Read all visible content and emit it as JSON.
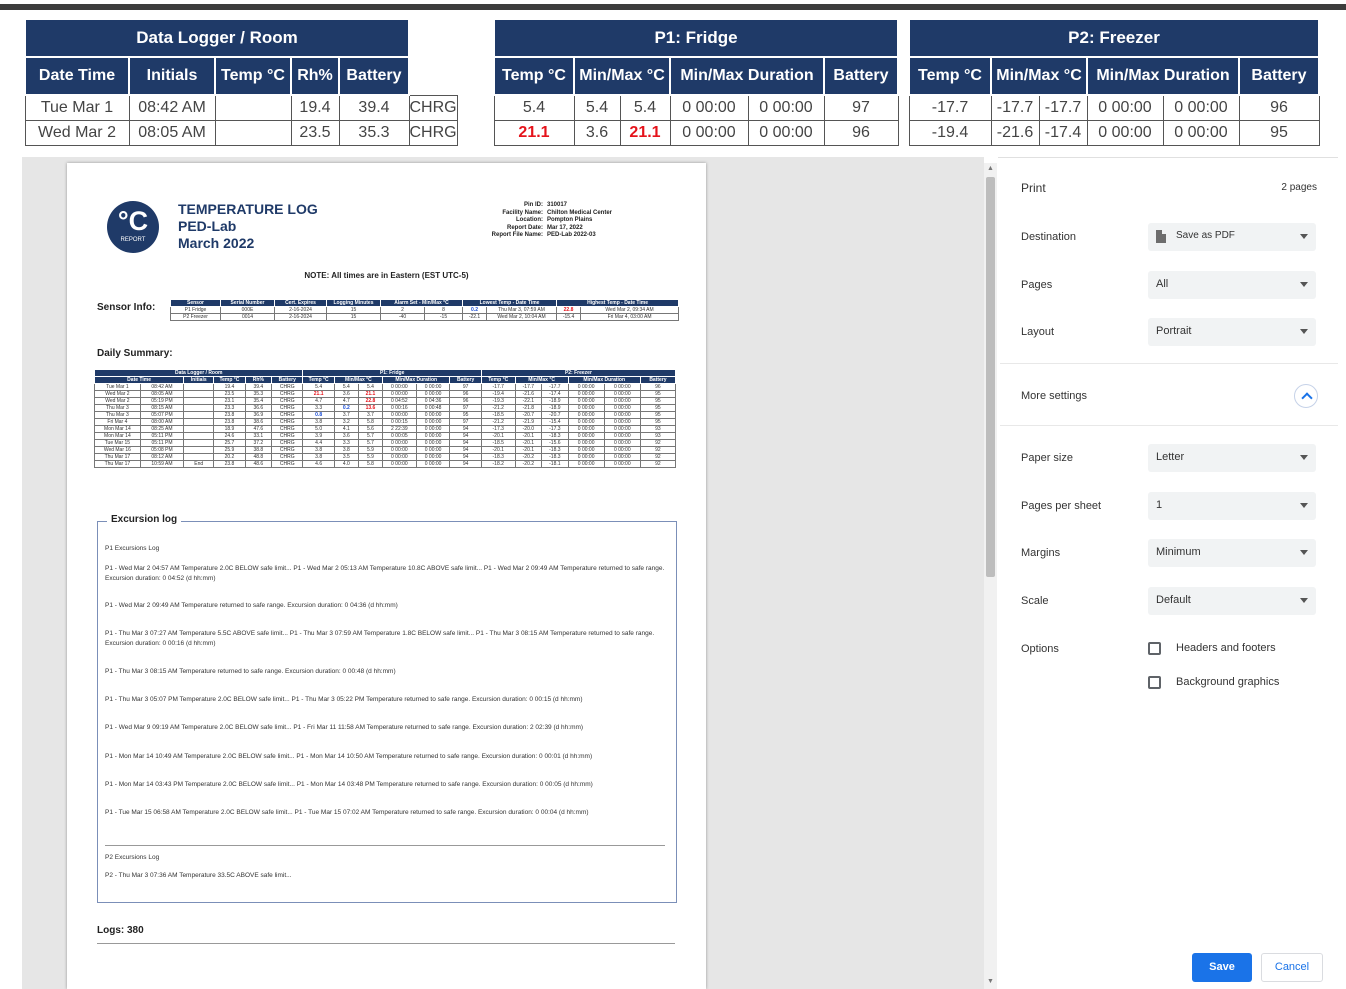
{
  "top_table": {
    "groups": [
      "Data Logger / Room",
      "P1: Fridge",
      "P2: Freezer"
    ],
    "room_headers": [
      "Date Time",
      "Initials",
      "Temp °C",
      "Rh%",
      "Battery"
    ],
    "probe_headers": [
      "Temp °C",
      "Min/Max °C",
      "Min/Max Duration",
      "Battery"
    ],
    "rows": [
      {
        "room": [
          "Tue Mar 1",
          "08:42 AM",
          "",
          "19.4",
          "39.4",
          "CHRG"
        ],
        "p1": [
          "5.4",
          "5.4",
          "5.4",
          "0 00:00",
          "0 00:00",
          "97"
        ],
        "p2": [
          "-17.7",
          "-17.7",
          "-17.7",
          "0 00:00",
          "0 00:00",
          "96"
        ]
      },
      {
        "room": [
          "Wed Mar 2",
          "08:05 AM",
          "",
          "23.5",
          "35.3",
          "CHRG"
        ],
        "p1": [
          "21.1",
          "3.6",
          "21.1",
          "0 00:00",
          "0 00:00",
          "96"
        ],
        "p2": [
          "-19.4",
          "-21.6",
          "-17.4",
          "0 00:00",
          "0 00:00",
          "95"
        ]
      }
    ]
  },
  "report": {
    "logo_main": "°C",
    "logo_sub": "REPORT",
    "title_lines": [
      "TEMPERATURE LOG",
      "PED-Lab",
      "March 2022"
    ],
    "meta": [
      {
        "k": "Pin ID:",
        "v": "310017"
      },
      {
        "k": "Facility Name:",
        "v": "Chilton Medical Center"
      },
      {
        "k": "Location:",
        "v": "Pompton Plains"
      },
      {
        "k": "Report Date:",
        "v": "Mar 17, 2022"
      },
      {
        "k": "Report File Name:",
        "v": "PED-Lab 2022-03"
      }
    ],
    "note": "NOTE: All times are in Eastern (EST UTC-5)",
    "sensor_label": "Sensor Info:",
    "sensor_headers": [
      "Sensor",
      "Serial Number",
      "Cert. Expires",
      "Logging Minutes",
      "Alarm Set - Min/Max °C",
      "Lowest Temp - Date Time",
      "Highest Temp - Date Time"
    ],
    "sensor_rows": [
      [
        "P1 Fridge",
        "000E",
        "2-16-2024",
        "15",
        "2",
        "8",
        "0.2",
        "Thu Mar 3, 07:59 AM",
        "22.8",
        "Wed Mar 2, 09:34 AM"
      ],
      [
        "P2 Freezer",
        "0014",
        "2-16-2024",
        "15",
        "-40",
        "-15",
        "-22.1",
        "Wed Mar 2, 10:04 AM",
        "-15.4",
        "Fri Mar 4, 03:00 AM"
      ]
    ],
    "daily_label": "Daily Summary:",
    "daily_groups": [
      "Data Logger / Room",
      "P1: Fridge",
      "P2: Freezer"
    ],
    "daily_headers": [
      "Date Time",
      "Initials",
      "Temp °C",
      "Rh%",
      "Battery",
      "Temp °C",
      "Min/Max °C",
      "Min/Max Duration",
      "Battery",
      "Temp °C",
      "Min/Max °C",
      "Min/Max Duration",
      "Battery"
    ],
    "daily_rows": [
      [
        "Tue Mar 1",
        "08:42 AM",
        "",
        "19.4",
        "39.4",
        "CHRG",
        "5.4",
        "5.4",
        "5.4",
        "0 00:00",
        "0 00:00",
        "97",
        "-17.7",
        "-17.7",
        "-17.7",
        "0 00:00",
        "0 00:00",
        "96"
      ],
      [
        "Wed Mar 2",
        "08:05 AM",
        "",
        "23.5",
        "35.3",
        "CHRG",
        "21.1",
        "3.6",
        "21.1",
        "0 00:00",
        "0 00:00",
        "96",
        "-19.4",
        "-21.6",
        "-17.4",
        "0 00:00",
        "0 00:00",
        "95"
      ],
      [
        "Wed Mar 2",
        "05:19 PM",
        "",
        "23.1",
        "35.4",
        "CHRG",
        "4.7",
        "4.7",
        "22.8",
        "0 04:52",
        "0 04:36",
        "96",
        "-19.3",
        "-22.1",
        "-18.9",
        "0 00:00",
        "0 00:00",
        "95"
      ],
      [
        "Thu Mar 3",
        "08:15 AM",
        "",
        "23.3",
        "36.6",
        "CHRG",
        "3.3",
        "0.2",
        "13.6",
        "0 00:16",
        "0 00:48",
        "97",
        "-21.2",
        "-21.8",
        "-18.9",
        "0 00:00",
        "0 00:00",
        "95"
      ],
      [
        "Thu Mar 3",
        "05:07 PM",
        "",
        "23.8",
        "36.9",
        "CHRG",
        "0.8",
        "3.7",
        "3.7",
        "0 00:00",
        "0 00:00",
        "95",
        "-18.5",
        "-20.7",
        "-20.7",
        "0 00:00",
        "0 00:00",
        "95"
      ],
      [
        "Fri Mar 4",
        "08:00 AM",
        "",
        "23.8",
        "38.6",
        "CHRG",
        "3.8",
        "3.2",
        "5.8",
        "0 00:15",
        "0 00:00",
        "97",
        "-21.2",
        "-21.9",
        "-15.4",
        "0 00:00",
        "0 00:00",
        "95"
      ],
      [
        "Mon Mar 14",
        "08:25 AM",
        "",
        "18.9",
        "47.6",
        "CHRG",
        "5.0",
        "4.1",
        "5.6",
        "2 22:39",
        "0 00:00",
        "94",
        "-17.3",
        "-20.0",
        "-17.3",
        "0 00:00",
        "0 00:00",
        "93"
      ],
      [
        "Mon Mar 14",
        "05:11 PM",
        "",
        "24.6",
        "33.1",
        "CHRG",
        "3.9",
        "3.6",
        "5.7",
        "0 00:05",
        "0 00:00",
        "94",
        "-20.1",
        "-20.1",
        "-18.3",
        "0 00:00",
        "0 00:00",
        "93"
      ],
      [
        "Tue Mar 15",
        "05:11 PM",
        "",
        "25.7",
        "37.2",
        "CHRG",
        "4.4",
        "3.3",
        "5.7",
        "0 00:00",
        "0 00:00",
        "94",
        "-18.5",
        "-20.1",
        "-15.6",
        "0 00:00",
        "0 00:00",
        "92"
      ],
      [
        "Wed Mar 16",
        "05:08 PM",
        "",
        "25.9",
        "38.8",
        "CHRG",
        "3.8",
        "3.8",
        "5.9",
        "0 00:00",
        "0 00:00",
        "94",
        "-20.1",
        "-20.1",
        "-18.3",
        "0 00:00",
        "0 00:00",
        "92"
      ],
      [
        "Thu Mar 17",
        "08:12 AM",
        "",
        "20.2",
        "48.8",
        "CHRG",
        "3.8",
        "3.5",
        "5.9",
        "0 00:00",
        "0 00:00",
        "94",
        "-18.3",
        "-20.2",
        "-18.3",
        "0 00:00",
        "0 00:00",
        "92"
      ],
      [
        "Thu Mar 17",
        "10:59 AM",
        "End",
        "23.8",
        "48.6",
        "CHRG",
        "4.6",
        "4.0",
        "5.8",
        "0 00:00",
        "0 00:00",
        "94",
        "-18.2",
        "-20.2",
        "-18.1",
        "0 00:00",
        "0 00:00",
        "92"
      ]
    ],
    "excursion_legend": "Excursion log",
    "p1_log_title": "P1 Excursions Log",
    "p1_entries": [
      "P1 - Wed Mar 2 04:57 AM Temperature 2.0C BELOW safe limit... P1 - Wed Mar 2 05:13 AM Temperature 10.8C ABOVE safe limit... P1 - Wed Mar 2 09:49 AM Temperature returned to safe range. Excursion duration: 0 04:52 (d hh:mm)",
      "P1 - Wed Mar 2 09:49 AM Temperature returned to safe range. Excursion duration: 0 04:36 (d hh:mm)",
      "P1 - Thu Mar 3 07:27 AM Temperature 5.5C ABOVE safe limit... P1 - Thu Mar 3 07:59 AM Temperature 1.8C BELOW safe limit... P1 - Thu Mar 3 08:15 AM Temperature returned to safe range. Excursion duration: 0 00:16 (d hh:mm)",
      "P1 - Thu Mar 3 08:15 AM Temperature returned to safe range. Excursion duration: 0 00:48 (d hh:mm)",
      "P1 - Thu Mar 3 05:07 PM Temperature 2.0C BELOW safe limit... P1 - Thu Mar 3 05:22 PM Temperature returned to safe range. Excursion duration: 0 00:15 (d hh:mm)",
      "P1 - Wed Mar 9 09:19 AM Temperature 2.0C BELOW safe limit... P1 - Fri Mar 11 11:58 AM Temperature returned to safe range. Excursion duration: 2 02:39 (d hh:mm)",
      "P1 - Mon Mar 14 10:49 AM Temperature 2.0C BELOW safe limit... P1 - Mon Mar 14 10:50 AM Temperature returned to safe range. Excursion duration: 0 00:01 (d hh:mm)",
      "P1 - Mon Mar 14 03:43 PM Temperature 2.0C BELOW safe limit... P1 - Mon Mar 14 03:48 PM Temperature returned to safe range. Excursion duration: 0 00:05 (d hh:mm)",
      "P1 - Tue Mar 15 06:58 AM Temperature 2.0C BELOW safe limit... P1 - Tue Mar 15 07:02 AM Temperature returned to safe range. Excursion duration: 0 00:04 (d hh:mm)"
    ],
    "p2_log_title": "P2 Excursions Log",
    "p2_entries": [
      "P2 - Thu Mar 3 07:36 AM Temperature 33.5C ABOVE safe limit..."
    ],
    "logs_label": "Logs: 380"
  },
  "print_panel": {
    "title": "Print",
    "page_count": "2 pages",
    "destination_label": "Destination",
    "destination_value": "Save as PDF",
    "pages_label": "Pages",
    "pages_value": "All",
    "layout_label": "Layout",
    "layout_value": "Portrait",
    "more_settings_label": "More settings",
    "paper_size_label": "Paper size",
    "paper_size_value": "Letter",
    "pages_per_sheet_label": "Pages per sheet",
    "pages_per_sheet_value": "1",
    "margins_label": "Margins",
    "margins_value": "Minimum",
    "scale_label": "Scale",
    "scale_value": "Default",
    "options_label": "Options",
    "option_headers_footers": "Headers and footers",
    "option_background_graphics": "Background graphics",
    "save_label": "Save",
    "cancel_label": "Cancel"
  }
}
